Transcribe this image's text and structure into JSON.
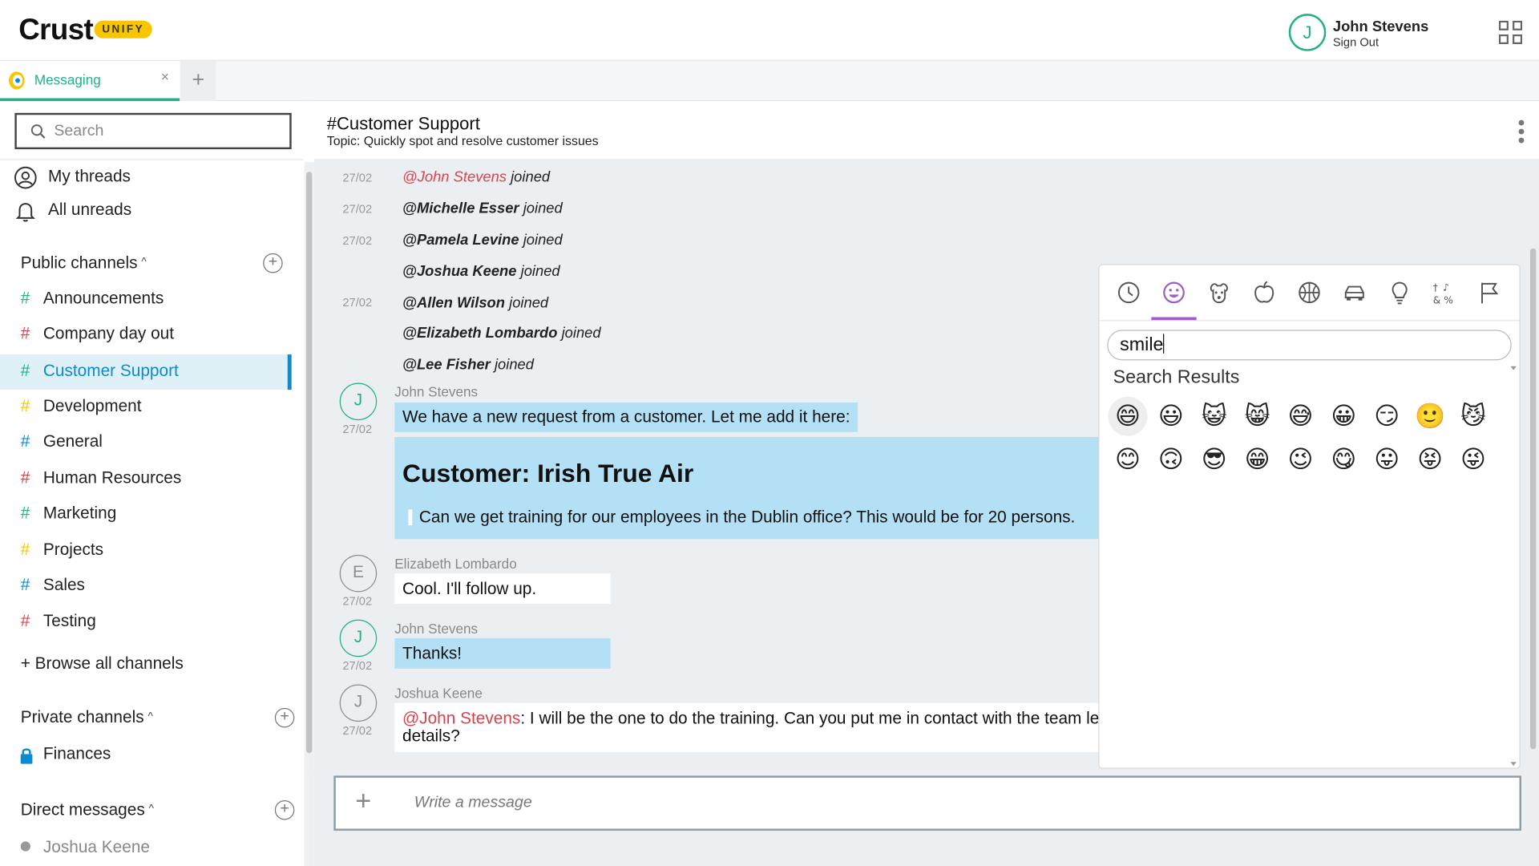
{
  "header": {
    "logo": "Crust",
    "badge": "UNIFY",
    "user": {
      "initial": "J",
      "name": "John Stevens",
      "signout": "Sign Out"
    }
  },
  "tabs": {
    "items": [
      {
        "label": "Messaging",
        "close": "×"
      }
    ],
    "add": "+"
  },
  "sidebar": {
    "search_placeholder": "Search",
    "my_threads": "My threads",
    "all_unreads": "All unreads",
    "public_title": "Public channels",
    "channels": [
      {
        "hash": "#",
        "name": "Announcements",
        "color": "#22b08a"
      },
      {
        "hash": "#",
        "name": "Company day out",
        "color": "#d9434e"
      },
      {
        "hash": "#",
        "name": "Customer Support",
        "color": "#22b08a"
      },
      {
        "hash": "#",
        "name": "Development",
        "color": "#f7c600"
      },
      {
        "hash": "#",
        "name": "General",
        "color": "#0b8bd0"
      },
      {
        "hash": "#",
        "name": "Human Resources",
        "color": "#d9434e"
      },
      {
        "hash": "#",
        "name": "Marketing",
        "color": "#22b08a"
      },
      {
        "hash": "#",
        "name": "Projects",
        "color": "#f7c600"
      },
      {
        "hash": "#",
        "name": "Sales",
        "color": "#0b8bd0"
      },
      {
        "hash": "#",
        "name": "Testing",
        "color": "#d9434e"
      }
    ],
    "browse": "+ Browse all channels",
    "private_title": "Private channels",
    "private_channels": [
      "Finances"
    ],
    "dm_title": "Direct messages",
    "dms": [
      "Joshua Keene"
    ]
  },
  "channel": {
    "title": "#Customer Support",
    "topic": "Topic: Quickly spot and resolve customer issues"
  },
  "system_messages": [
    {
      "date": "27/02",
      "user": "@John Stevens",
      "action": "joined",
      "mention": true
    },
    {
      "date": "27/02",
      "user": "@Michelle Esser",
      "action": "joined",
      "mention": false
    },
    {
      "date": "27/02",
      "user": "@Pamela Levine",
      "action": "joined",
      "mention": false
    },
    {
      "date": "",
      "user": "@Joshua Keene",
      "action": "joined",
      "mention": false
    },
    {
      "date": "27/02",
      "user": "@Allen Wilson",
      "action": "joined",
      "mention": false
    },
    {
      "date": "",
      "user": "@Elizabeth Lombardo",
      "action": "joined",
      "mention": false
    },
    {
      "date": "",
      "user": "@Lee Fisher",
      "action": "joined",
      "mention": false
    }
  ],
  "messages": [
    {
      "initial": "J",
      "author": "John Stevens",
      "date": "27/02",
      "text": "We have a new request from a customer. Let me add it here:"
    },
    {
      "initial": "E",
      "author": "Elizabeth Lombardo",
      "date": "27/02",
      "text": "Cool. I'll follow up."
    },
    {
      "initial": "J",
      "author": "John Stevens",
      "date": "27/02",
      "text": "Thanks!"
    },
    {
      "initial": "J",
      "author": "Joshua Keene",
      "date": "27/02",
      "mention": "@John Stevens",
      "text": ": I will be the one to do the training. Can you put me in contact with the team le",
      "text2": "details?"
    }
  ],
  "card": {
    "title": "Customer: Irish True Air",
    "quote": "Can we get training for our employees in the Dublin office? This would be for 20 persons."
  },
  "composer": {
    "placeholder": "Write a message",
    "add": "+"
  },
  "emoji_picker": {
    "categories": [
      "recent-icon",
      "smiley-icon",
      "animal-icon",
      "food-icon",
      "sports-icon",
      "car-icon",
      "lightbulb-icon",
      "symbols-icon",
      "flag-icon"
    ],
    "search_value": "smile",
    "results_title": "Search Results",
    "results": [
      "😄",
      "😃",
      "😺",
      "😸",
      "😅",
      "😀",
      "😏",
      "🙂",
      "😼",
      "😊",
      "🙃",
      "😎",
      "😁",
      "😉",
      "😋",
      "😛",
      "😝",
      "😜"
    ]
  },
  "colors": {
    "accent": "#22b08a",
    "blue": "#0b8bd0",
    "mention": "#d9434e",
    "bubble": "#b3e0f5",
    "picker_active": "#a05cc8"
  }
}
